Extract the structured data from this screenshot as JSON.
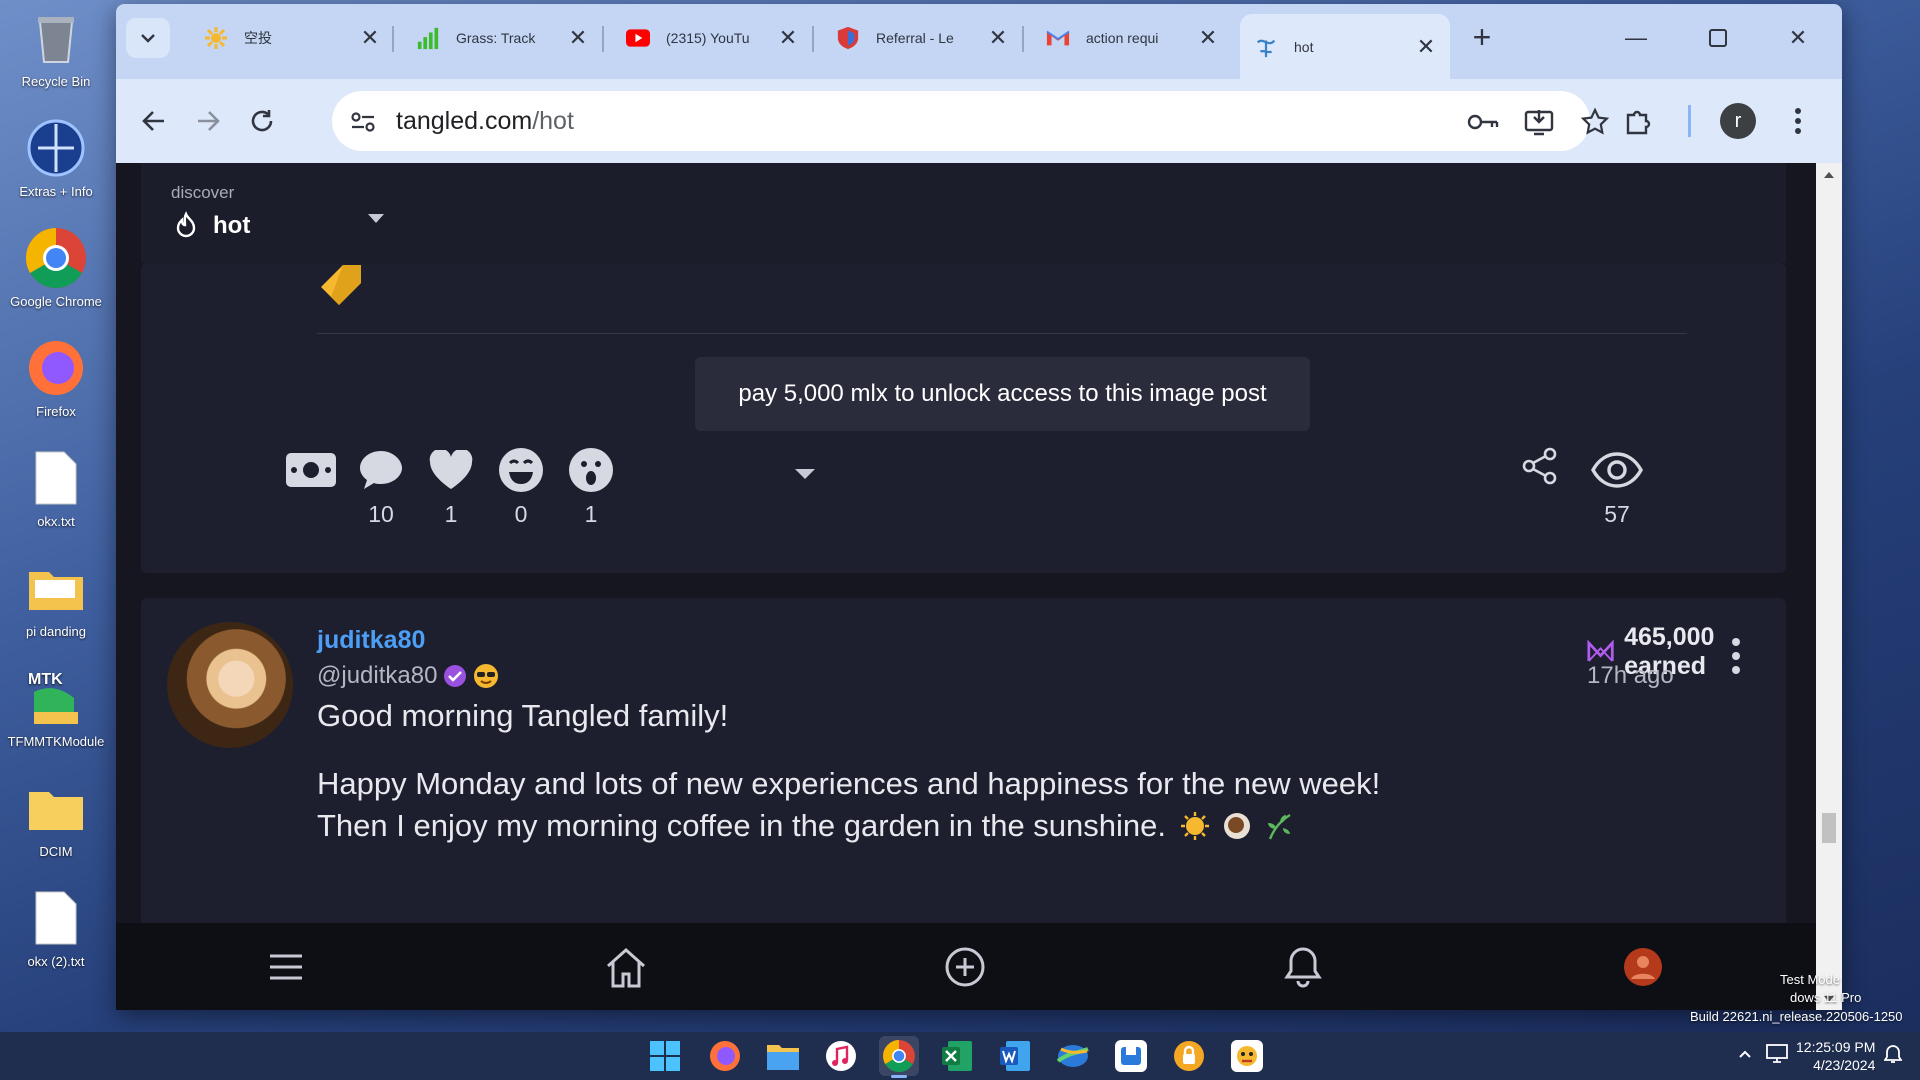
{
  "desktop": {
    "icons": [
      {
        "label": "Recycle Bin"
      },
      {
        "label": "Extras + Info"
      },
      {
        "label": "Google Chrome"
      },
      {
        "label": "Firefox"
      },
      {
        "label": "okx.txt"
      },
      {
        "label": "pi danding"
      },
      {
        "label": "TFMMTKModule"
      },
      {
        "label": "DCIM"
      },
      {
        "label": "okx (2).txt"
      }
    ],
    "watermark": {
      "line1": "Test Mode",
      "line2": "dows 11 Pro",
      "line3": "Build 22621.ni_release.220506-1250"
    }
  },
  "browser": {
    "tabs": [
      {
        "title": "空投",
        "icon": "sun-flower-icon"
      },
      {
        "title": "Grass: Track",
        "icon": "grass-signal-icon"
      },
      {
        "title": "(2315) YouTu",
        "icon": "youtube-icon"
      },
      {
        "title": "Referral - Le",
        "icon": "shield-logo-icon"
      },
      {
        "title": "action requi",
        "icon": "gmail-icon"
      },
      {
        "title": "hot",
        "icon": "tangled-icon",
        "active": true
      }
    ],
    "url_host": "tangled.com",
    "url_path": "/hot",
    "profile_initial": "r"
  },
  "page": {
    "header": {
      "discover_label": "discover",
      "feed_label": "hot"
    },
    "post1": {
      "unlock_text": "pay 5,000 mlx to unlock access to this image post",
      "reactions": [
        {
          "icon": "tip-money-icon",
          "count": ""
        },
        {
          "icon": "comment-icon",
          "count": "10"
        },
        {
          "icon": "heart-icon",
          "count": "1"
        },
        {
          "icon": "laugh-emoji-icon",
          "count": "0"
        },
        {
          "icon": "wow-emoji-icon",
          "count": "1"
        }
      ],
      "views": "57"
    },
    "post2": {
      "display_name": "juditka80",
      "handle": "@juditka80",
      "earned": "465,000 earned",
      "time_ago": "17h ago",
      "line1": "Good morning Tangled family!",
      "line2": "Happy Monday and lots of new experiences and happiness for the new week!",
      "line3": "Then I enjoy my morning coffee in the garden in the sunshine."
    }
  },
  "taskbar": {
    "time": "12:25:09 PM",
    "date": "4/23/2024"
  },
  "colors": {
    "accent_blue": "#4d9ef5",
    "card_bg": "#1e1f2e",
    "page_bg": "#15161f",
    "tag_gold": "#f5b82e",
    "mlx_purple": "#b15cf0"
  }
}
